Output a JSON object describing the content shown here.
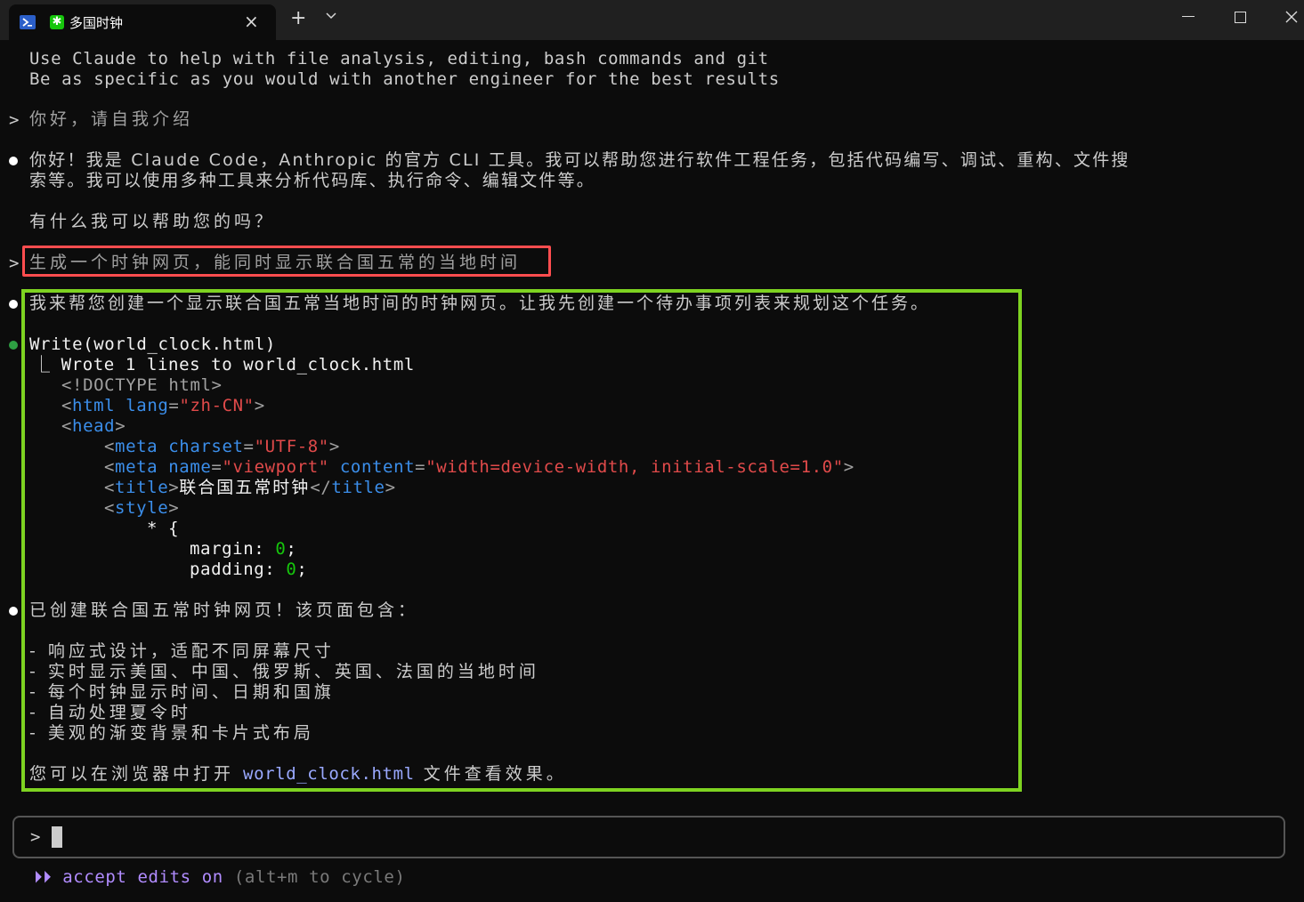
{
  "window": {
    "tab_title": "多国时钟",
    "close_tab_glyph": "×",
    "new_tab_glyph": "+"
  },
  "intro": {
    "line1": "Use Claude to help with file analysis, editing, bash commands and git",
    "line2": "Be as specific as you would with another engineer for the best results"
  },
  "conversation": {
    "prompt_symbol": ">",
    "user_message_1": "你好，请自我介绍",
    "assistant_reply_1_line1": "你好！我是 Claude Code，Anthropic 的官方 CLI 工具。我可以帮助您进行软件工程任务，包括代码编写、调试、重构、文件搜",
    "assistant_reply_1_line2": "索等。我可以使用多种工具来分析代码库、执行命令、编辑文件等。",
    "assistant_reply_1_line3": "有什么我可以帮助您的吗？",
    "user_message_2": "生成一个时钟网页，能同时显示联合国五常的当地时间",
    "assistant_reply_2": "我来帮您创建一个显示联合国五常当地时间的时钟网页。让我先创建一个待办事项列表来规划这个任务。",
    "tool_call": "Write(world_clock.html)",
    "tool_result": "⎿ Wrote 1 lines to world_clock.html",
    "code_preview": {
      "doctype": "<!DOCTYPE html>",
      "html_tag": "html",
      "lang_attr": "lang",
      "lang_val": "\"zh-CN\"",
      "head_tag": "head",
      "meta_tag": "meta",
      "charset_attr": "charset",
      "charset_val": "\"UTF-8\"",
      "name_attr": "name",
      "name_val": "\"viewport\"",
      "content_attr": "content",
      "content_val": "\"width=device-width, initial-scale=1.0\"",
      "title_tag": "title",
      "title_text": "联合国五常时钟",
      "style_tag": "style",
      "selector": "* {",
      "margin_prop": "margin: ",
      "padding_prop": "padding: ",
      "zero": "0"
    },
    "summary_intro": "已创建联合国五常时钟网页！该页面包含：",
    "features": [
      "- 响应式设计，适配不同屏幕尺寸",
      "- 实时显示美国、中国、俄罗斯、英国、法国的当地时间",
      "- 每个时钟显示时间、日期和国旗",
      "- 自动处理夏令时",
      "- 美观的渐变背景和卡片式布局"
    ],
    "closing_prefix": "您可以在浏览器中打开 ",
    "closing_file": "world_clock.html",
    "closing_suffix": " 文件查看效果。"
  },
  "input": {
    "prompt_symbol": ">",
    "value": ""
  },
  "footer": {
    "mode_label": "⏵⏵ accept edits on",
    "hint": " (alt+m to cycle)"
  },
  "colors": {
    "highlight_red": "#ff4d4f",
    "highlight_green": "#7ed321",
    "keyword_blue": "#3b8eea",
    "string_red": "#e04a4a",
    "accept_purple": "#b18cff"
  }
}
